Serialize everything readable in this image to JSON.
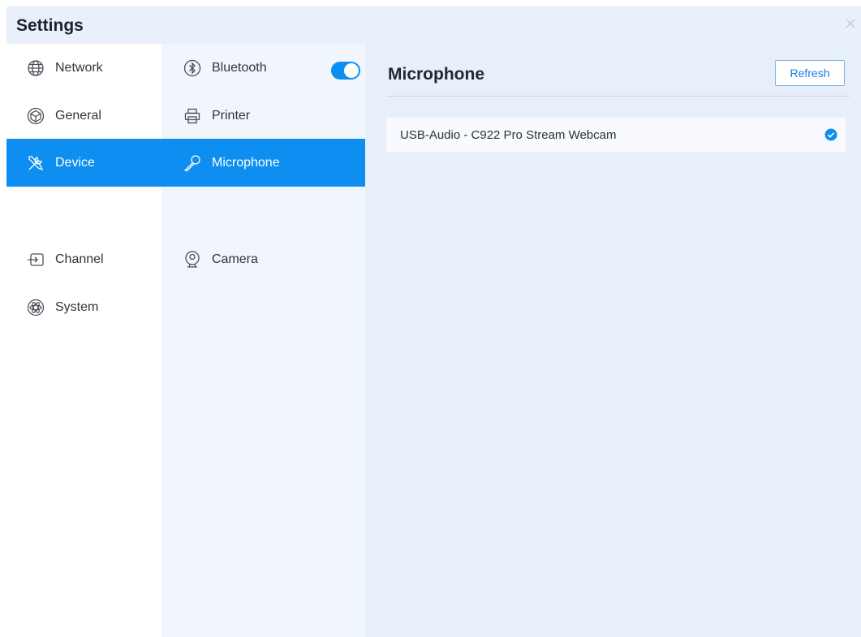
{
  "window": {
    "title": "Settings"
  },
  "categories": [
    {
      "label": "Network",
      "icon": "globe-icon"
    },
    {
      "label": "General",
      "icon": "cube-icon"
    },
    {
      "label": "Device",
      "icon": "tools-icon",
      "selected": true
    },
    {
      "label": "Channel",
      "icon": "input-source-icon"
    },
    {
      "label": "System",
      "icon": "atom-icon"
    }
  ],
  "subcategories": [
    {
      "label": "Bluetooth",
      "icon": "bluetooth-icon",
      "toggle_on": true
    },
    {
      "label": "Printer",
      "icon": "printer-icon"
    },
    {
      "label": "Microphone",
      "icon": "microphone-icon",
      "selected": true
    },
    {
      "label": "Camera",
      "icon": "webcam-icon"
    }
  ],
  "panel": {
    "title": "Microphone",
    "refresh_label": "Refresh",
    "devices": [
      {
        "name": "USB-Audio - C922 Pro Stream Webcam",
        "selected": true
      }
    ]
  },
  "colors": {
    "accent": "#0e8ef0",
    "background": "#e9f0fb"
  }
}
